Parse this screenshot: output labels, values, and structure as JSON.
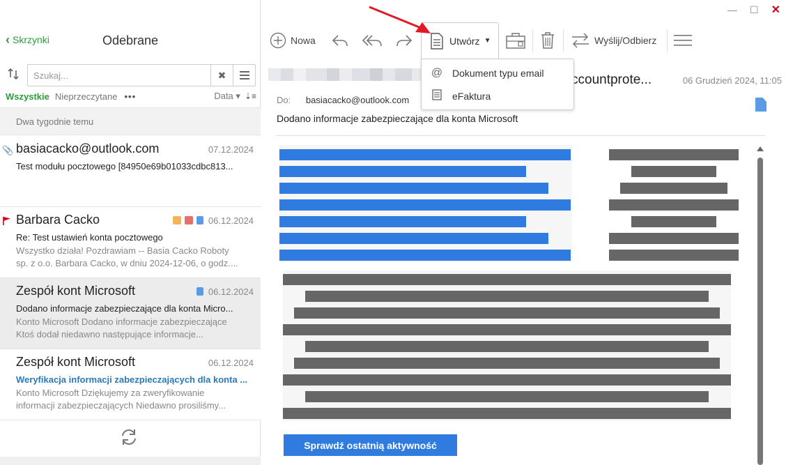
{
  "window": {
    "minimize": "—",
    "maximize": "☐",
    "close": "✕"
  },
  "left": {
    "back_label": "Skrzynki",
    "title": "Odebrane",
    "search_placeholder": "Szukaj...",
    "filters": {
      "all": "Wszystkie",
      "unread": "Nieprzeczytane",
      "more": "•••",
      "sort": "Data ▾"
    },
    "group": "Dwa tygodnie temu",
    "messages": [
      {
        "from": "basiacacko@outlook.com",
        "date": "07.12.2024",
        "subject": "Test modułu pocztowego [84950e69b01033cdbc813...",
        "preview": []
      },
      {
        "from": "Barbara Cacko",
        "date": "06.12.2024",
        "subject": "Re: Test ustawień konta pocztowego",
        "preview": [
          "Wszystko działa! Pozdrawiam -- Basia Cacko Roboty",
          "sp. z o.o. Barbara Cacko, w dniu 2024-12-06, o godz...."
        ]
      },
      {
        "from": "Zespół kont Microsoft",
        "date": "06.12.2024",
        "subject": "Dodano informacje zabezpieczające dla konta Micro...",
        "preview": [
          "Konto Microsoft Dodano informacje zabezpieczające",
          "Ktoś dodał niedawno następujące informacje..."
        ]
      },
      {
        "from": "Zespół kont Microsoft",
        "date": "06.12.2024",
        "subject": "Weryfikacja informacji zabezpieczających dla konta ...",
        "preview": [
          "Konto Microsoft Dziękujemy za zweryfikowanie",
          "informacji zabezpieczających Niedawno prosiliśmy..."
        ]
      }
    ]
  },
  "toolbar": {
    "new_label": "Nowa",
    "create_label": "Utwórz",
    "send_receive_label": "Wyślij/Odbierz"
  },
  "dropdown": {
    "items": [
      "Dokument typu email",
      "eFaktura"
    ]
  },
  "reading": {
    "sender": "ccountprote...",
    "date": "06 Grudzień 2024, 11:05",
    "to_label": "Do:",
    "to_addr": "basiacacko@outlook.com",
    "subject": "Dodano informacje zabezpieczające dla konta Microsoft",
    "cta": "Sprawdź ostatnią aktywność"
  },
  "colors": {
    "accent_green": "#2e9c3d",
    "link_blue": "#2a7ab8",
    "cta_blue": "#2f7be0",
    "arrow_red": "#e01b24"
  }
}
